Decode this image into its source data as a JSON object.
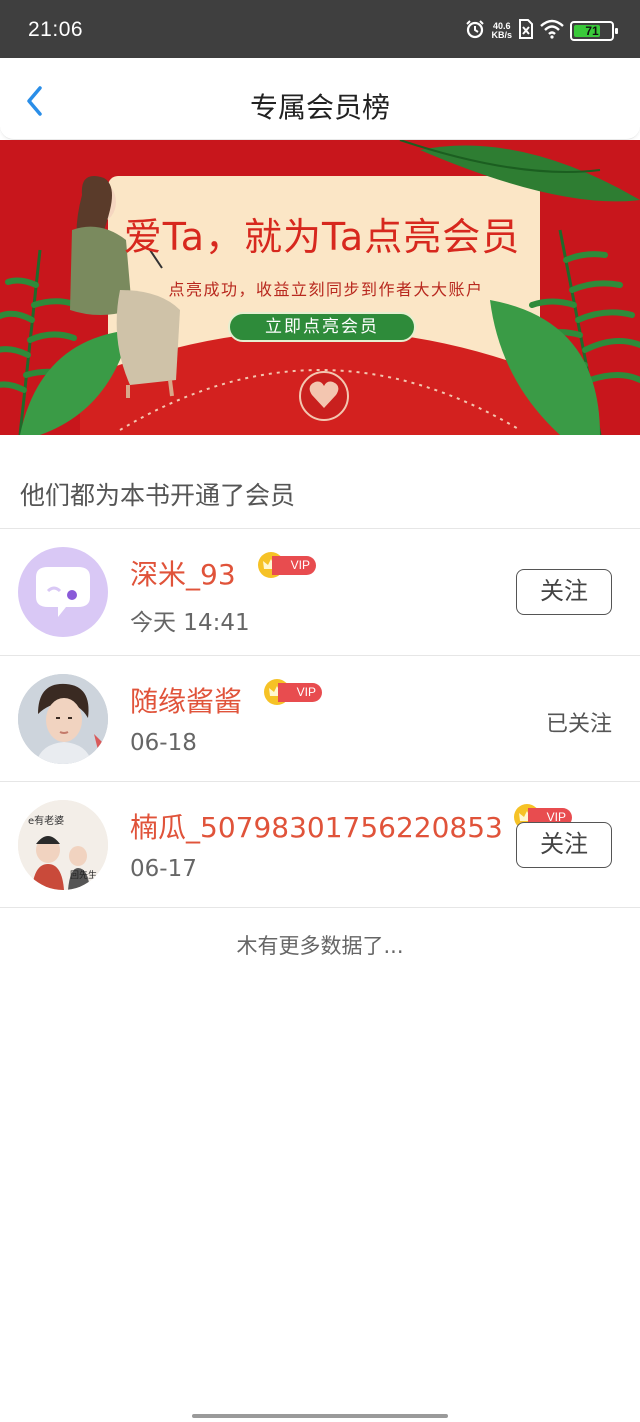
{
  "status_bar": {
    "time": "21:06",
    "net_speed_value": "40.6",
    "net_speed_unit": "KB/s",
    "battery_level": "71",
    "icons": [
      "alarm-icon",
      "sim-off-icon",
      "wifi-icon",
      "battery-icon"
    ]
  },
  "header": {
    "title": "专属会员榜",
    "back_icon": "chevron-left-icon"
  },
  "banner": {
    "headline": "爱Ta，就为Ta点亮会员",
    "subtitle": "点亮成功，收益立刻同步到作者大大账户",
    "cta": "立即点亮会员"
  },
  "section": {
    "heading": "他们都为本书开通了会员"
  },
  "members": [
    {
      "name": "深米_93",
      "date": "今天  14:41",
      "vip": "VIP",
      "action": "关注",
      "followed": false
    },
    {
      "name": "随缘酱酱",
      "date": "06-18",
      "vip": "VIP",
      "action": "已关注",
      "followed": true
    },
    {
      "name": "楠瓜_50798301756220853",
      "date": "06-17",
      "vip": "VIP",
      "action": "关注",
      "followed": false
    }
  ],
  "footer": {
    "note": "木有更多数据了..."
  },
  "colors": {
    "status_bar_bg": "#3f3f3f",
    "accent_blue": "#2a8ee8",
    "name_red": "#e0533a",
    "banner_red": "#c8161c",
    "vip_pill": "#e84c4f",
    "vip_crown": "#f6c226",
    "battery_green": "#3ac93a"
  }
}
